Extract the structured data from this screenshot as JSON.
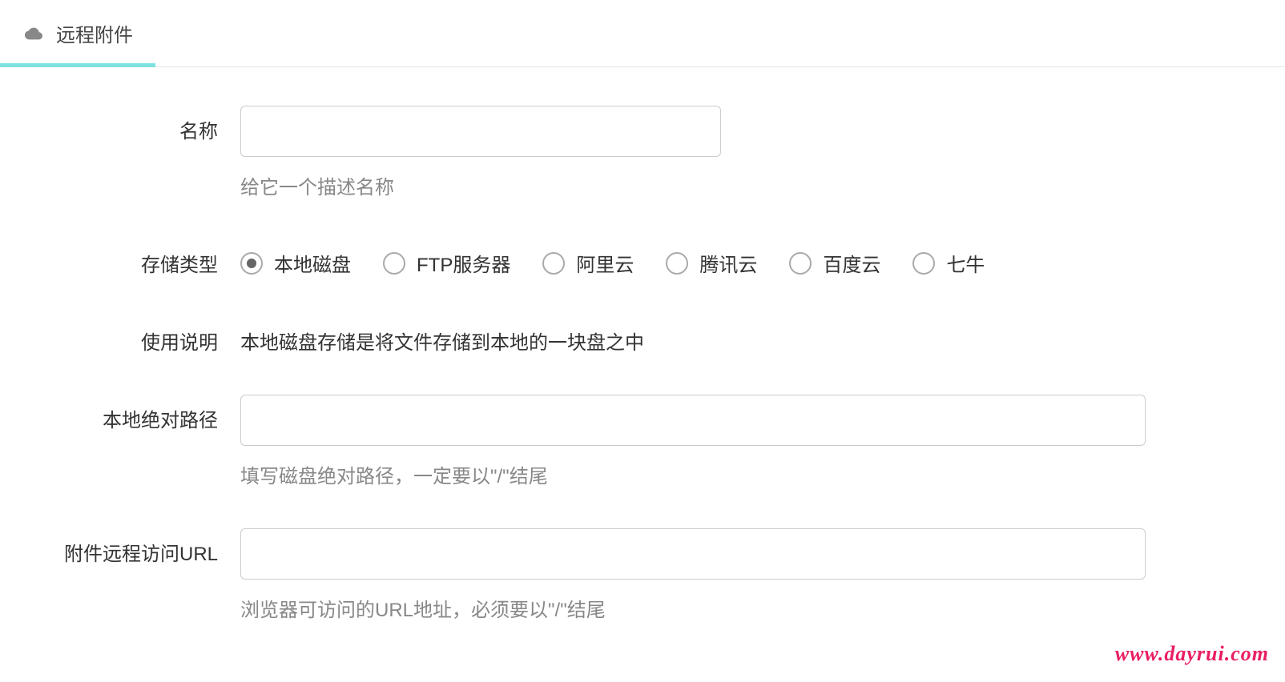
{
  "tab": {
    "label": "远程附件"
  },
  "form": {
    "name": {
      "label": "名称",
      "value": "",
      "help": "给它一个描述名称"
    },
    "storage_type": {
      "label": "存储类型",
      "options": [
        {
          "label": "本地磁盘",
          "selected": true
        },
        {
          "label": "FTP服务器",
          "selected": false
        },
        {
          "label": "阿里云",
          "selected": false
        },
        {
          "label": "腾讯云",
          "selected": false
        },
        {
          "label": "百度云",
          "selected": false
        },
        {
          "label": "七牛",
          "selected": false
        }
      ]
    },
    "usage": {
      "label": "使用说明",
      "text": "本地磁盘存储是将文件存储到本地的一块盘之中"
    },
    "local_path": {
      "label": "本地绝对路径",
      "value": "",
      "help": "填写磁盘绝对路径，一定要以\"/\"结尾"
    },
    "remote_url": {
      "label": "附件远程访问URL",
      "value": "",
      "help": "浏览器可访问的URL地址，必须要以\"/\"结尾"
    }
  },
  "watermark": "www.dayrui.com"
}
